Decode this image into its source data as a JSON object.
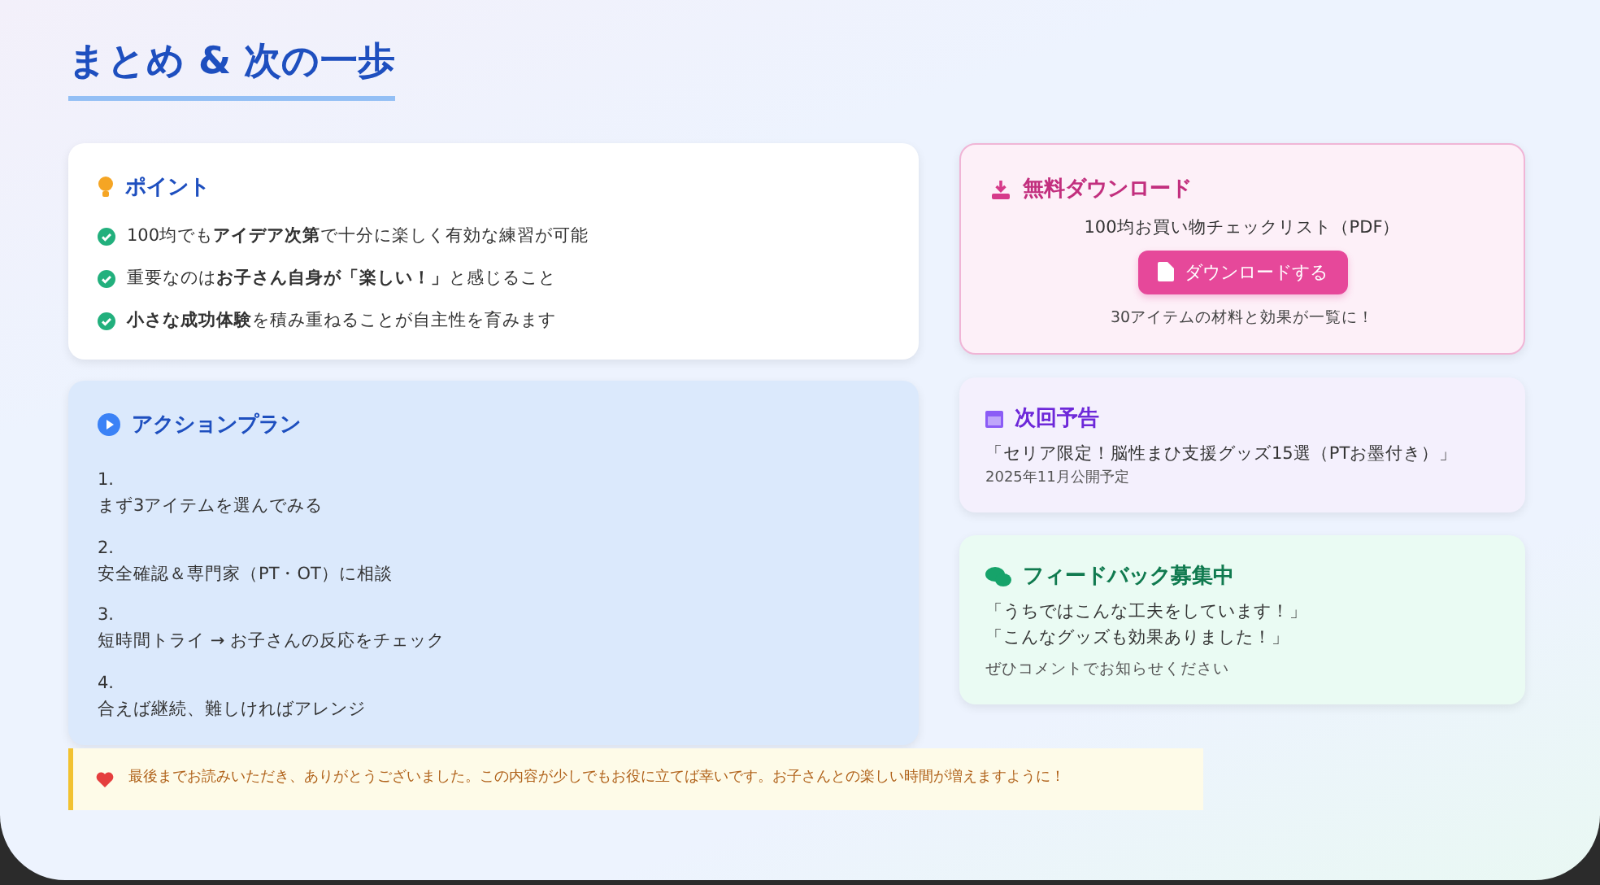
{
  "title": "まとめ & 次の一歩",
  "points": {
    "heading": "ポイント",
    "items": [
      {
        "text": "100均でも**アイデア次第**で十分に楽しく有効な練習が可能"
      },
      {
        "text": "重要なのは**お子さん自身が「楽しい！」**と感じること"
      },
      {
        "text": "**小さな成功体験**を積み重ねることが自主性を育みます"
      }
    ]
  },
  "action_plan": {
    "heading": "アクションプラン",
    "steps": [
      {
        "number": "1.",
        "text": "まず3アイテムを選んでみる"
      },
      {
        "number": "2.",
        "text": "安全確認＆専門家（PT・OT）に相談"
      },
      {
        "number": "3.",
        "text": "短時間トライ → お子さんの反応をチェック"
      },
      {
        "number": "4.",
        "text": "合えば継続、難しければアレンジ"
      }
    ]
  },
  "download": {
    "heading": "無料ダウンロード",
    "item": "100均お買い物チェックリスト（PDF）",
    "button": "ダウンロードする",
    "note": "30アイテムの材料と効果が一覧に！"
  },
  "next": {
    "heading": "次回予告",
    "title": "「セリア限定！脳性まひ支援グッズ15選（PTお墨付き）」",
    "date": "2025年11月公開予定"
  },
  "feedback": {
    "heading": "フィードバック募集中",
    "quotes": [
      "「うちではこんな工夫をしています！」",
      "「こんなグッズも効果ありました！」"
    ],
    "note": "ぜひコメントでお知らせください"
  },
  "closing": "最後までお読みいただき、ありがとうございました。この内容が少しでもお役に立てば幸いです。お子さんとの楽しい時間が増えますように！"
}
